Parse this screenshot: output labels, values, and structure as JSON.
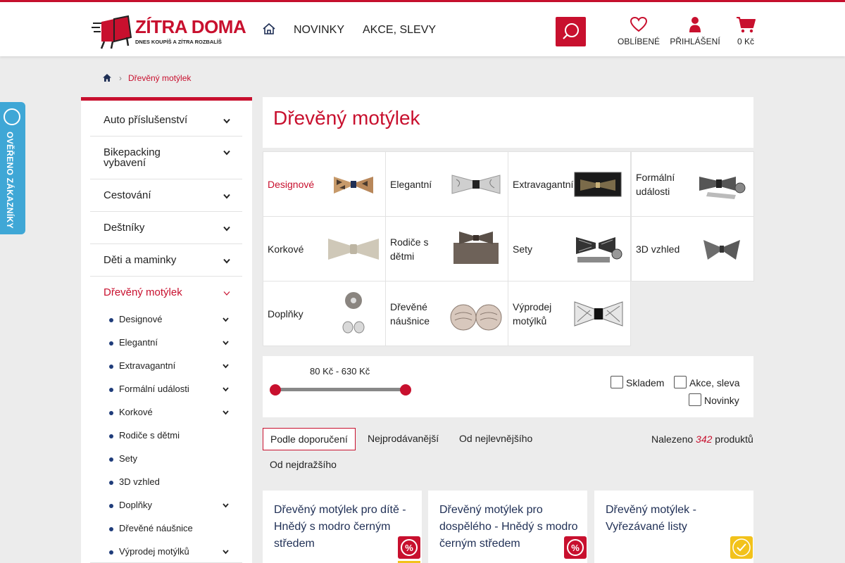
{
  "header": {
    "logo_title": "ZÍTRA DOMA",
    "logo_tagline": "DNES KOUPÍŠ A ZÍTRA ROZBALÍŠ",
    "nav": [
      "NOVINKY",
      "AKCE, SLEVY"
    ],
    "favorites_label": "OBLÍBENÉ",
    "login_label": "PŘIHLÁŠENÍ",
    "cart_label": "0 Kč"
  },
  "feedback_tab": {
    "label": "OVĚŘENO ZÁKAZNÍKY"
  },
  "breadcrumb": {
    "current": "Dřevěný motýlek"
  },
  "sidebar": {
    "items": [
      {
        "label": "Auto příslušenství"
      },
      {
        "label": "Bikepacking vybavení"
      },
      {
        "label": "Cestování"
      },
      {
        "label": "Deštníky"
      },
      {
        "label": "Děti a maminky"
      },
      {
        "label": "Dřevěný motýlek"
      }
    ],
    "subitems": [
      {
        "label": "Designové"
      },
      {
        "label": "Elegantní"
      },
      {
        "label": "Extravagantní"
      },
      {
        "label": "Formální události"
      },
      {
        "label": "Korkové"
      },
      {
        "label": "Rodiče s dětmi"
      },
      {
        "label": "Sety"
      },
      {
        "label": "3D vzhled"
      },
      {
        "label": "Doplňky"
      },
      {
        "label": "Dřevěné náušnice"
      },
      {
        "label": "Výprodej motýlků"
      }
    ]
  },
  "page_title": "Dřevěný motýlek",
  "categories": [
    {
      "label": "Designové"
    },
    {
      "label": "Elegantní"
    },
    {
      "label": "Extravagantní"
    },
    {
      "label": "Formální události"
    },
    {
      "label": "Korkové"
    },
    {
      "label": "Rodiče s dětmi"
    },
    {
      "label": "Sety"
    },
    {
      "label": "3D vzhled"
    },
    {
      "label": "Doplňky"
    },
    {
      "label": "Dřevěné náušnice"
    },
    {
      "label": "Výprodej motýlků"
    }
  ],
  "filters": {
    "price_range": "80 Kč - 630 Kč",
    "in_stock": "Skladem",
    "sale": "Akce, sleva",
    "new": "Novinky"
  },
  "sort": {
    "tabs": [
      "Podle doporučení",
      "Nejprodávanější",
      "Od nejlevnějšího",
      "Od nejdražšího"
    ],
    "found_prefix": "Nalezeno",
    "found_count": "342",
    "found_suffix": "produktů"
  },
  "products": [
    {
      "name": "Dřevěný motýlek pro dítě - Hnědý s modro černým středem"
    },
    {
      "name": "Dřevěný motýlek pro dospělého - Hnědý s modro černým středem"
    },
    {
      "name": "Dřevěný motýlek - Vyřezávané listy"
    }
  ],
  "colors": {
    "brand_red": "#c8102e",
    "feedback_blue": "#3fa7d6",
    "badge_yellow": "#f2c21b"
  }
}
